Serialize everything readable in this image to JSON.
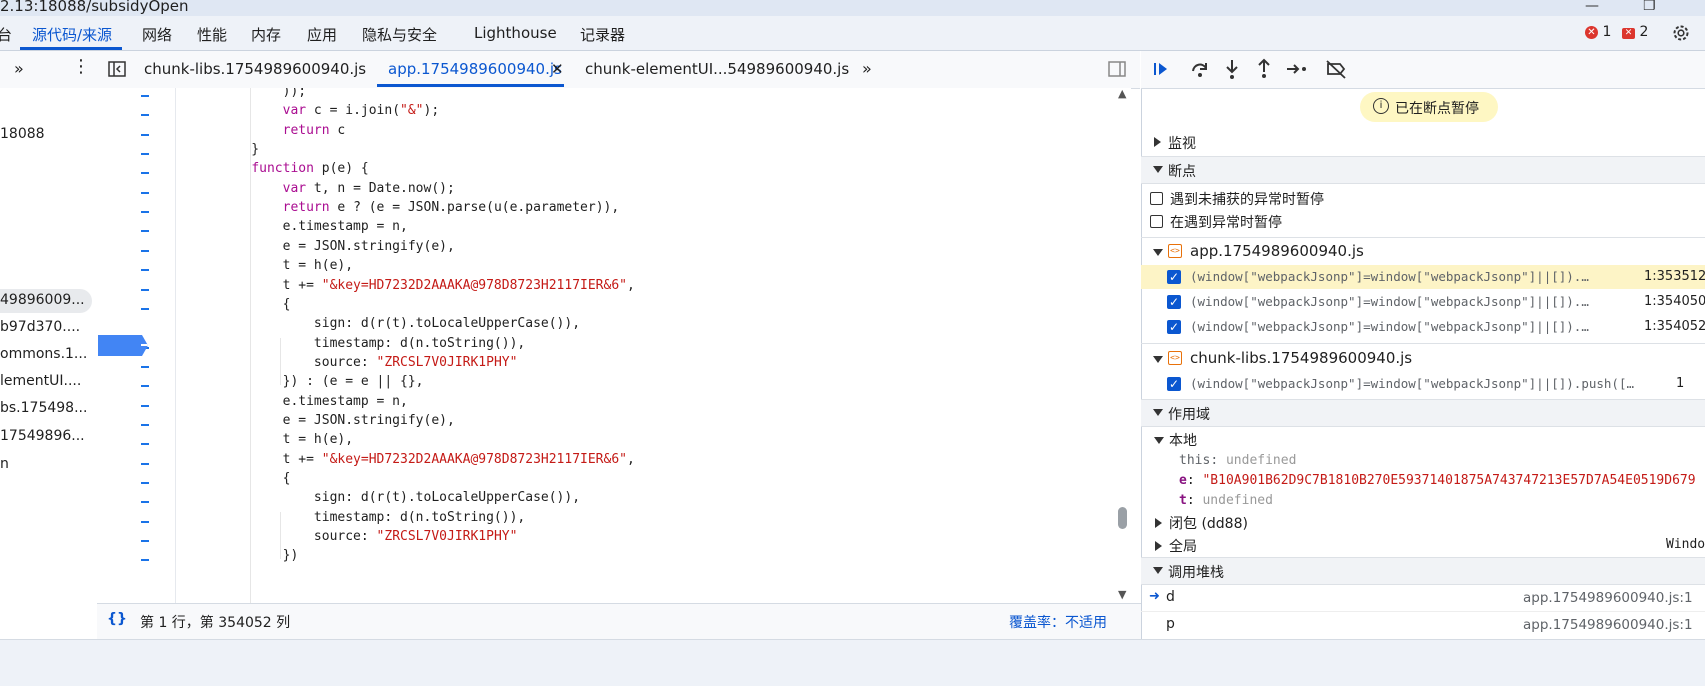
{
  "window": {
    "title": "2.13:18088/subsidyOpen"
  },
  "panel_tabs": [
    "台",
    "源代码/来源",
    "网络",
    "性能",
    "内存",
    "应用",
    "隐私与安全",
    "Lighthouse",
    "记录器"
  ],
  "counters": {
    "errors": "1",
    "issues": "2"
  },
  "file_tabs": [
    "chunk-libs.1754989600940.js",
    "app.1754989600940.js",
    "chunk-elementUI...54989600940.js"
  ],
  "navigator": {
    "items": [
      "18088",
      "49896009...",
      "b97d370....",
      "ommons.1...",
      "lementUI....",
      "bs.175498...",
      "17549896...",
      "n"
    ]
  },
  "code": {
    "lines": [
      "        ));",
      "        var c = i.join(\"&\");",
      "        return c",
      "    }",
      "    function p(e) {",
      "        var t, n = Date.now();",
      "        return e ? (e = JSON.parse(u(e.parameter)),",
      "        e.timestamp = n,",
      "        e = JSON.stringify(e),",
      "        t = h(e),",
      "        t += \"&key=HD7232D2AAAKA@978D8723H2117IER&6\",",
      "        {",
      "            sign: d(r(t).toLocaleUpperCase()),",
      "            timestamp: d(n.toString()),",
      "            source: \"ZRCSL7V0JIRK1PHY\"",
      "        }) : (e = e || {},",
      "        e.timestamp = n,",
      "        e = JSON.stringify(e),",
      "        t = h(e),",
      "        t += \"&key=HD7232D2AAAKA@978D8723H2117IER&6\",",
      "        {",
      "            sign: d(r(t).toLocaleUpperCase()),",
      "            timestamp: d(n.toString()),",
      "            source: \"ZRCSL7V0JIRK1PHY\"",
      "        })"
    ]
  },
  "status": {
    "position": "第 1 行，第 354052 列",
    "coverage": "覆盖率：不适用"
  },
  "debugger": {
    "paused_label": "已在断点暂停",
    "watch": "监视",
    "breakpoints": "断点",
    "pause_uncaught": "遇到未捕获的异常时暂停",
    "pause_caught": "在遇到异常时暂停",
    "bp_files": [
      {
        "name": "app.1754989600940.js",
        "items": [
          {
            "code": "(window[\"webpackJsonp\"]=window[\"webpackJsonp\"]||[]).…",
            "loc": "1:353512"
          },
          {
            "code": "(window[\"webpackJsonp\"]=window[\"webpackJsonp\"]||[]).…",
            "loc": "1:354050"
          },
          {
            "code": "(window[\"webpackJsonp\"]=window[\"webpackJsonp\"]||[]).…",
            "loc": "1:354052"
          }
        ]
      },
      {
        "name": "chunk-libs.1754989600940.js",
        "items": [
          {
            "code": "(window[\"webpackJsonp\"]=window[\"webpackJsonp\"]||[]).push([…",
            "loc": "1"
          }
        ]
      }
    ],
    "scope": "作用域",
    "local": "本地",
    "vars": [
      {
        "name": "this",
        "value": "undefined"
      },
      {
        "name": "e",
        "value": "\"B10A901B62D9C7B1810B270E59371401875A743747213E57D7A54E0519D679"
      },
      {
        "name": "t",
        "value": "undefined"
      }
    ],
    "closure": "闭包 (dd88)",
    "global": "全局",
    "global_value": "Window",
    "callstack": "调用堆栈",
    "frames": [
      {
        "name": "d",
        "loc": "app.1754989600940.js:1"
      },
      {
        "name": "p",
        "loc": "app.1754989600940.js:1"
      }
    ]
  },
  "colors": {
    "accent": "#0b57d0",
    "error": "#dc362e",
    "keyword": "#aa0d91",
    "string": "#c41a16"
  }
}
